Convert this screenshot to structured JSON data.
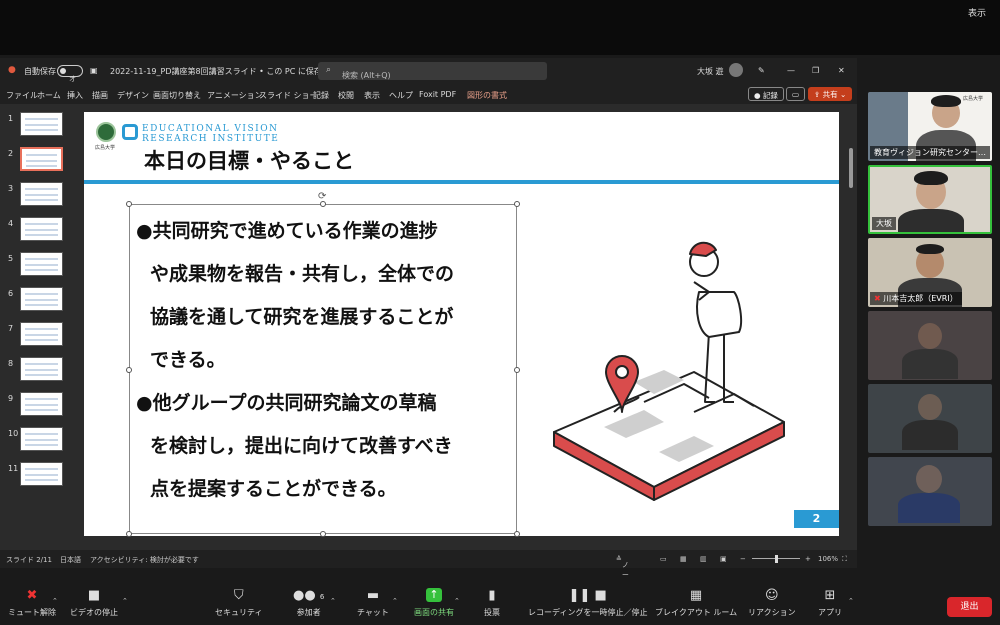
{
  "zoom_top": {
    "view_label": "表示"
  },
  "ppt": {
    "autosave_label": "自動保存",
    "autosave_state": "オフ",
    "doc_title": "2022-11-19_PD講座第8回講習スライド • この PC に保存済み ⌄",
    "search_placeholder": "検索 (Alt+Q)",
    "user_name": "大坂 遊",
    "menu": [
      "ファイル",
      "ホーム",
      "挿入",
      "描画",
      "デザイン",
      "画面切り替え",
      "アニメーション",
      "スライド ショー",
      "記録",
      "校閲",
      "表示",
      "ヘルプ",
      "Foxit PDF",
      "図形の書式"
    ],
    "record_label": "記録",
    "share_label": "共有",
    "thumb_numbers": [
      "1",
      "2",
      "3",
      "4",
      "5",
      "6",
      "7",
      "8",
      "9",
      "10",
      "11"
    ],
    "status": {
      "slide_pos": "スライド 2/11",
      "language": "日本語",
      "accessibility": "アクセシビリティ: 検討が必要です",
      "notes": "ノート",
      "zoom": "106%"
    }
  },
  "slide": {
    "univ_label": "広島大学",
    "evri_line1": "EDUCATIONAL VISION",
    "evri_line2": "RESEARCH INSTITUTE",
    "title": "本日の目標・やること",
    "lines": [
      "●共同研究で進めている作業の進捗",
      "や成果物を報告・共有し，全体での",
      "協議を通して研究を進展することが",
      "できる。",
      "●他グループの共同研究論文の草稿",
      "を検討し，提出に向けて改善すべき",
      "点を提案することができる。"
    ],
    "page_number": "2"
  },
  "participants": [
    {
      "name": "教育ヴィジョン研究センター…",
      "logo": "広島大学"
    },
    {
      "name": "大坂"
    },
    {
      "name": "川本吉太郎（EVRI）"
    }
  ],
  "toolbar": {
    "mute": "ミュート解除",
    "video": "ビデオの停止",
    "security": "セキュリティ",
    "participants": "参加者",
    "participants_count": "6",
    "chat": "チャット",
    "share": "画面の共有",
    "poll": "投票",
    "recording": "レコーディングを一時停止／停止",
    "breakout": "ブレイクアウト ルーム",
    "reactions": "リアクション",
    "apps": "アプリ",
    "leave": "退出"
  },
  "colors": {
    "accent": "#2a9ad3",
    "ppt_red": "#c43e1c",
    "zoom_green": "#35c13c",
    "leave_red": "#d9262b"
  }
}
